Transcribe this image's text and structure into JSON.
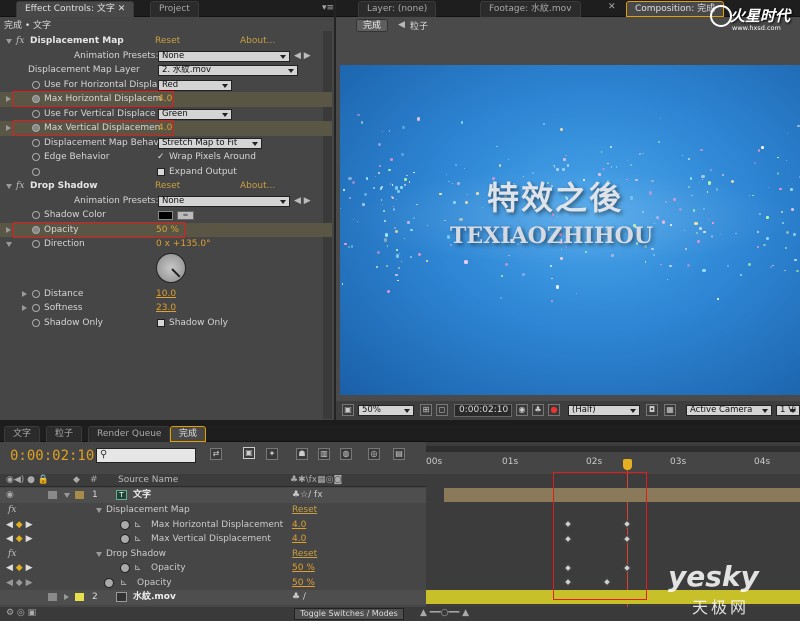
{
  "effect_controls": {
    "tab_label": "Effect Controls: 文字",
    "project_tab": "Project",
    "breadcrumb": "完成 • 文字",
    "displacement": {
      "name": "Displacement Map",
      "reset": "Reset",
      "about": "About...",
      "presets_label": "Animation Presets:",
      "presets_value": "None",
      "layer_label": "Displacement Map Layer",
      "layer_value": "2. 水紋.mov",
      "use_h_label": "Use For Horizontal Displa",
      "use_h_value": "Red",
      "max_h_label": "Max Horizontal Displacem",
      "max_h_value": "4.0",
      "use_v_label": "Use For Vertical Displace",
      "use_v_value": "Green",
      "max_v_label": "Max Vertical Displacemen",
      "max_v_value": "4.0",
      "behavior_label": "Displacement Map Behavi",
      "behavior_value": "Stretch Map to Fit",
      "edge_label": "Edge Behavior",
      "wrap_label": "Wrap Pixels Around",
      "expand_label": "Expand Output"
    },
    "drop_shadow": {
      "name": "Drop Shadow",
      "reset": "Reset",
      "about": "About...",
      "presets_label": "Animation Presets:",
      "presets_value": "None",
      "color_label": "Shadow Color",
      "opacity_label": "Opacity",
      "opacity_value": "50 %",
      "direction_label": "Direction",
      "direction_value": "0 x +135.0°",
      "distance_label": "Distance",
      "distance_value": "10.0",
      "softness_label": "Softness",
      "softness_value": "23.0",
      "shadow_only_label": "Shadow Only",
      "shadow_only_check": "Shadow Only"
    }
  },
  "viewer": {
    "layer_tab": "Layer: (none)",
    "footage_tab": "Footage: 水紋.mov",
    "comp_tab": "Composition: 完成",
    "comp_breadcrumb_1": "完成",
    "comp_breadcrumb_2": "粒子",
    "title_cn": "特效之後",
    "title_en": "TEXIAOZHIHOU",
    "zoom": "50%",
    "timecode": "0:00:02:10",
    "resolution": "(Half)",
    "camera": "Active Camera",
    "view": "1 Vi"
  },
  "watermark": {
    "top": "火星时代",
    "top_url": "www.hxsd.com",
    "bottom": "yesky",
    "bottom_cn": "天极网"
  },
  "timeline": {
    "tabs": [
      "文字",
      "粒子",
      "Render Queue",
      "完成"
    ],
    "timecode": "0:00:02:10",
    "search_placeholder": "",
    "col_hash": "#",
    "col_source": "Source Name",
    "ruler": [
      "00s",
      "01s",
      "02s",
      "03s",
      "04s"
    ],
    "layer1_num": "1",
    "layer1_name": "文字",
    "disp_group": "Displacement Map",
    "disp_reset": "Reset",
    "max_h_label": "Max Horizontal Displacement",
    "max_h_value": "4.0",
    "max_v_label": "Max Vertical Displacement",
    "max_v_value": "4.0",
    "shadow_group": "Drop Shadow",
    "shadow_reset": "Reset",
    "opacity_label": "Opacity",
    "opacity_value": "50 %",
    "opacity2_label": "Opacity",
    "opacity2_value": "50 %",
    "layer2_num": "2",
    "layer2_name": "水紋.mov",
    "toggle_label": "Toggle Switches / Modes"
  }
}
